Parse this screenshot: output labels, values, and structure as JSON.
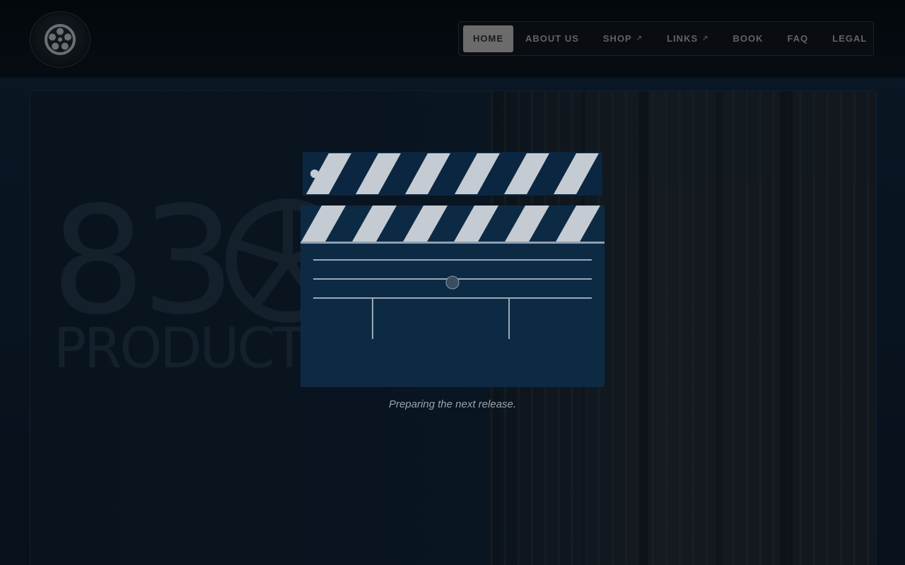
{
  "nav": {
    "items": [
      {
        "label": "HOME",
        "active": true,
        "external": false
      },
      {
        "label": "ABOUT US",
        "active": false,
        "external": false
      },
      {
        "label": "SHOP",
        "active": false,
        "external": true
      },
      {
        "label": "LINKS",
        "active": false,
        "external": true
      },
      {
        "label": "BOOK",
        "active": false,
        "external": false
      },
      {
        "label": "FAQ",
        "active": false,
        "external": false
      },
      {
        "label": "LEGAL",
        "active": false,
        "external": false
      }
    ],
    "external_icon": "↗"
  },
  "brand": {
    "number": "83",
    "word": "PRODUCTIONS"
  },
  "loader": {
    "caption": "Preparing the next release.",
    "progress_percent": 50
  },
  "icons": {
    "logo": "film-reel-icon",
    "external": "external-link-icon"
  },
  "colors": {
    "background": "#081420",
    "nav_active": "#6b6b6b",
    "clapper_body": "#0d2a45",
    "clapper_stripe": "#c5cbd2"
  }
}
